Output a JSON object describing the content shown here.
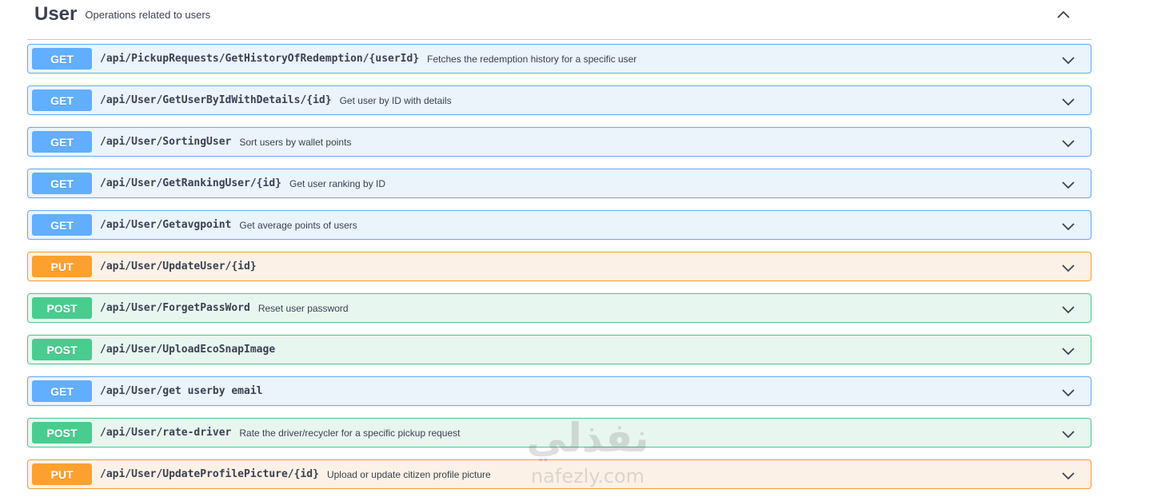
{
  "section": {
    "title": "User",
    "description": "Operations related to users"
  },
  "watermark": {
    "arabic": "نفذلي",
    "latin": "nafezly.com"
  },
  "operations": [
    {
      "method": "GET",
      "type": "get",
      "path": "/api/PickupRequests/GetHistoryOfRedemption/{userId}",
      "summary": "Fetches the redemption history for a specific user"
    },
    {
      "method": "GET",
      "type": "get",
      "path": "/api/User/GetUserByIdWithDetails/{id}",
      "summary": "Get user by ID with details"
    },
    {
      "method": "GET",
      "type": "get",
      "path": "/api/User/SortingUser",
      "summary": "Sort users by wallet points"
    },
    {
      "method": "GET",
      "type": "get",
      "path": "/api/User/GetRankingUser/{id}",
      "summary": "Get user ranking by ID"
    },
    {
      "method": "GET",
      "type": "get",
      "path": "/api/User/Getavgpoint",
      "summary": "Get average points of users"
    },
    {
      "method": "PUT",
      "type": "put",
      "path": "/api/User/UpdateUser/{id}",
      "summary": ""
    },
    {
      "method": "POST",
      "type": "post",
      "path": "/api/User/ForgetPassWord",
      "summary": "Reset user password"
    },
    {
      "method": "POST",
      "type": "post",
      "path": "/api/User/UploadEcoSnapImage",
      "summary": ""
    },
    {
      "method": "GET",
      "type": "get",
      "path": "/api/User/get userby email",
      "summary": ""
    },
    {
      "method": "POST",
      "type": "post",
      "path": "/api/User/rate-driver",
      "summary": "Rate the driver/recycler for a specific pickup request"
    },
    {
      "method": "PUT",
      "type": "put",
      "path": "/api/User/UpdateProfilePicture/{id}",
      "summary": "Upload or update citizen profile picture"
    }
  ]
}
